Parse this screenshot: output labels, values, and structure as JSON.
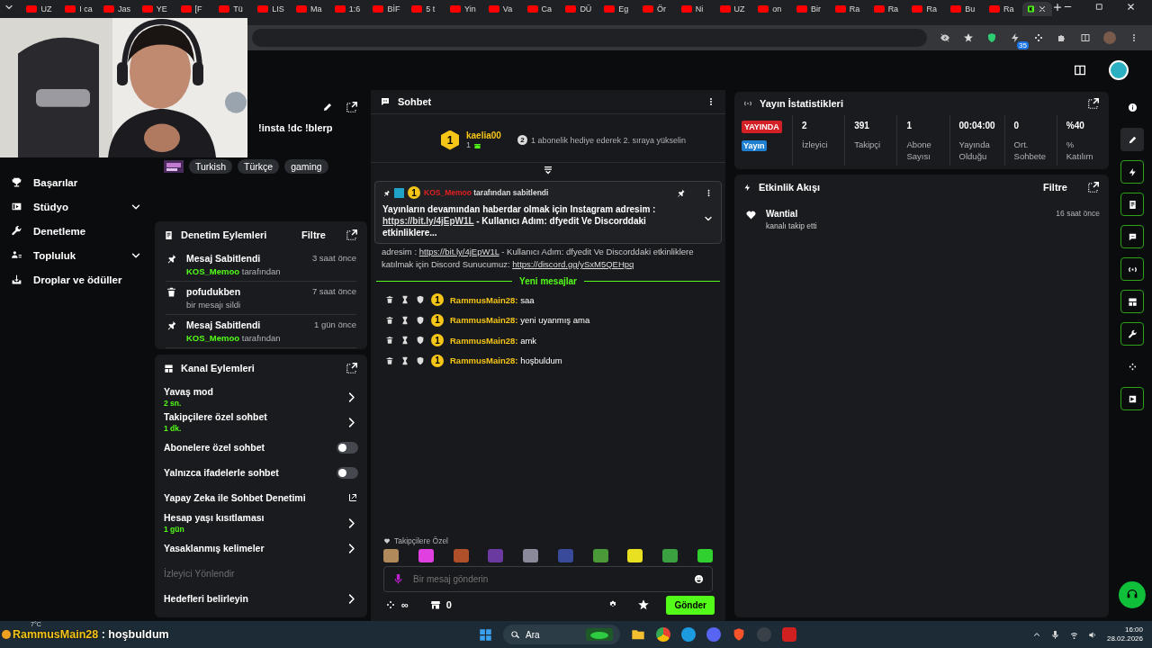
{
  "browser": {
    "tabs": [
      {
        "label": "UZ",
        "selected": false
      },
      {
        "label": "I ca",
        "selected": false
      },
      {
        "label": "Jas",
        "selected": false
      },
      {
        "label": "YE",
        "selected": false
      },
      {
        "label": "[F",
        "selected": false
      },
      {
        "label": "Tü",
        "selected": false
      },
      {
        "label": "LIS",
        "selected": false
      },
      {
        "label": "Ma",
        "selected": false
      },
      {
        "label": "1:6",
        "selected": false
      },
      {
        "label": "BİF",
        "selected": false
      },
      {
        "label": "5 t",
        "selected": false
      },
      {
        "label": "Yin",
        "selected": false
      },
      {
        "label": "Va",
        "selected": false
      },
      {
        "label": "Ca",
        "selected": false
      },
      {
        "label": "DÜ",
        "selected": false
      },
      {
        "label": "Eg",
        "selected": false
      },
      {
        "label": "Ör",
        "selected": false
      },
      {
        "label": "Ni",
        "selected": false
      },
      {
        "label": "UZ",
        "selected": false
      },
      {
        "label": "on",
        "selected": false
      },
      {
        "label": "Bir",
        "selected": false
      },
      {
        "label": "Ra",
        "selected": false
      },
      {
        "label": "Ra",
        "selected": false
      },
      {
        "label": "Ra",
        "selected": false
      },
      {
        "label": "Bu",
        "selected": false
      },
      {
        "label": "Ra",
        "selected": false
      },
      {
        "kind": "app",
        "selected": true
      }
    ],
    "extension_badge": "35"
  },
  "sidebar": {
    "items": [
      {
        "label": "Başarılar",
        "kind": "trophy"
      },
      {
        "label": "Stüdyo",
        "kind": "studio",
        "expanded": false
      },
      {
        "label": "Denetleme",
        "kind": "wrench"
      },
      {
        "label": "Topluluk",
        "kind": "people",
        "expanded": false
      },
      {
        "label": "Droplar ve ödüller",
        "kind": "drop"
      }
    ]
  },
  "stream_info": {
    "commands": "!insta !dc !blerp",
    "tags": [
      "Turkish",
      "Türkçe",
      "gaming"
    ]
  },
  "mod_actions": {
    "title": "Denetim Eylemleri",
    "filter": "Filtre",
    "rows": [
      {
        "kind": "pin",
        "title": "Mesaj Sabitlendi",
        "detail": "**KOS_Memoo** tarafından",
        "time": "3 saat önce"
      },
      {
        "kind": "trash",
        "title": "pofudukben",
        "detail": "bir mesajı sildi",
        "time": "7 saat önce"
      },
      {
        "kind": "pin",
        "title": "Mesaj Sabitlendi",
        "detail": "**KOS_Memoo** tarafından",
        "time": "1 gün önce"
      }
    ]
  },
  "channel_actions": {
    "title": "Kanal Eylemleri",
    "items": [
      {
        "kind": "nav",
        "label": "Yavaş mod",
        "value": "2 sn."
      },
      {
        "kind": "nav",
        "label": "Takipçilere özel sohbet",
        "value": "1 dk."
      },
      {
        "kind": "toggle",
        "label": "Abonelere özel sohbet",
        "on": false
      },
      {
        "kind": "toggle",
        "label": "Yalnızca ifadelerle sohbet",
        "on": false
      },
      {
        "kind": "external",
        "label": "Yapay Zeka ile Sohbet Denetimi"
      },
      {
        "kind": "nav",
        "label": "Hesap yaşı kısıtlaması",
        "value": "1 gün"
      },
      {
        "kind": "nav",
        "label": "Yasaklanmış kelimeler"
      },
      {
        "kind": "section",
        "label": "İzleyici Yönlendir"
      },
      {
        "kind": "nav",
        "label": "Hedefleri belirleyin"
      }
    ]
  },
  "chat": {
    "title": "Sohbet",
    "leader": {
      "rank": "1",
      "name": "kaelia00",
      "gifts": "1"
    },
    "next": {
      "rank": "2",
      "text": "1 abonelik hediye ederek 2. sıraya yükselin"
    },
    "pinned": {
      "badge": "1",
      "user": "KOS_Memoo",
      "text": "tarafından sabitlendi",
      "parts": [
        {
          "kind": "text",
          "text": "Yayınların devamından haberdar olmak için Instagram adresim :"
        },
        {
          "kind": "link",
          "text": "https://bit.ly/4jEpW1L"
        },
        {
          "kind": "text",
          "text": "- Kullanıcı Adım: dfyedit Ve Discorddaki etkinliklere..."
        }
      ]
    },
    "partial_message": {
      "parts": [
        {
          "kind": "text",
          "text": "adresim :"
        },
        {
          "kind": "link",
          "text": "https://bit.ly/4jEpW1L"
        },
        {
          "kind": "text",
          "text": "- Kullanıcı Adım: dfyedit Ve Discorddaki etkinliklere katılmak için Discord Sunucumuz:"
        },
        {
          "kind": "link",
          "text": "https://discord.gg/ySxM5QEHpq"
        }
      ]
    },
    "new_messages_label": "Yeni mesajlar",
    "messages": [
      {
        "badge": "1",
        "user": "RammusMain28:",
        "text": "saa"
      },
      {
        "badge": "1",
        "user": "RammusMain28:",
        "text": "yeni uyanmış ama"
      },
      {
        "badge": "1",
        "user": "RammusMain28:",
        "text": "amk"
      },
      {
        "badge": "1",
        "user": "RammusMain28:",
        "text": "hoşbuldum"
      }
    ],
    "emote_label": "Takipçilere Özel",
    "emotes": [
      {
        "color": "#b08a5a"
      },
      {
        "color": "#e040e0"
      },
      {
        "color": "#b0502a"
      },
      {
        "color": "#6a3aa0"
      },
      {
        "color": "#8a8a9a"
      },
      {
        "color": "#3a4a9a"
      },
      {
        "color": "#4a9a3a"
      },
      {
        "color": "#e8e020"
      },
      {
        "color": "#3aa040"
      },
      {
        "color": "#30d030"
      }
    ],
    "input": {
      "placeholder": "Bir mesaj gönderin"
    },
    "points": "∞",
    "store_count": "0",
    "send": "Gönder"
  },
  "stats": {
    "title": "Yayın İstatistikleri",
    "live_badge": "YAYINDA",
    "live_label": "Yayın",
    "items": [
      {
        "value": "2",
        "label": "İzleyici"
      },
      {
        "value": "391",
        "label": "Takipçi"
      },
      {
        "value": "1",
        "label": "Abone Sayısı"
      },
      {
        "value": "00:04:00",
        "label": "Yayında Olduğu"
      },
      {
        "value": "0",
        "label": "Ort. Sohbete"
      },
      {
        "value": "%40",
        "label": "% Katılım"
      }
    ]
  },
  "activity": {
    "title": "Etkinlik Akışı",
    "filter": "Filtre",
    "events": [
      {
        "user": "Wantial",
        "text": "kanalı takip etti",
        "time": "16 saat önce"
      }
    ]
  },
  "rail": {
    "items": [
      {
        "kind": "info",
        "selected": false,
        "highlight": false
      },
      {
        "kind": "pencil",
        "selected": true,
        "highlight": false
      },
      {
        "kind": "bolt",
        "selected": false,
        "highlight": true
      },
      {
        "kind": "doc",
        "selected": false,
        "highlight": true
      },
      {
        "kind": "chat",
        "selected": false,
        "highlight": true
      },
      {
        "kind": "broadcast",
        "selected": false,
        "highlight": true
      },
      {
        "kind": "layout",
        "selected": false,
        "highlight": true
      },
      {
        "kind": "wrench",
        "selected": false,
        "highlight": true
      },
      {
        "kind": "dots",
        "selected": false,
        "highlight": false
      },
      {
        "kind": "clip",
        "selected": false,
        "highlight": true
      }
    ]
  },
  "chat_overlay": {
    "user": "RammusMain28",
    "text": ": hoşbuldum"
  },
  "taskbar": {
    "weather": "7°C",
    "search": "Ara",
    "time": "16:00",
    "date": "28.02.2026"
  }
}
